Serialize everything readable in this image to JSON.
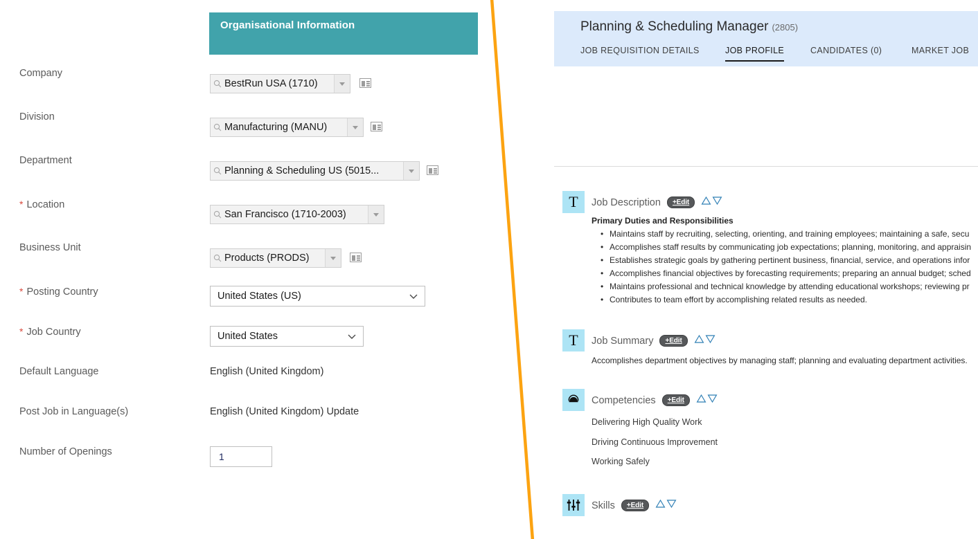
{
  "left_form": {
    "section_header": "Organisational Information",
    "fields": [
      {
        "label": "Company",
        "required": false,
        "type": "value-help",
        "value": "BestRun USA (1710)",
        "has_card_icon": true,
        "icon": "magnifier-icon"
      },
      {
        "label": "Division",
        "required": false,
        "type": "value-help",
        "value": "Manufacturing (MANU)",
        "has_card_icon": true,
        "icon": "magnifier-icon"
      },
      {
        "label": "Department",
        "required": false,
        "type": "value-help",
        "value": "Planning & Scheduling US (5015...",
        "has_card_icon": true,
        "icon": "magnifier-icon"
      },
      {
        "label": "Location",
        "required": true,
        "type": "value-help",
        "value": "San Francisco (1710-2003)",
        "has_card_icon": false,
        "icon": "magnifier-icon"
      },
      {
        "label": "Business Unit",
        "required": false,
        "type": "value-help",
        "value": "Products (PRODS)",
        "has_card_icon": true,
        "icon": "magnifier-icon"
      },
      {
        "label": "Posting Country",
        "required": true,
        "type": "select",
        "value": "United States (US)"
      },
      {
        "label": "Job Country",
        "required": true,
        "type": "select",
        "value": "United States"
      },
      {
        "label": "Default Language",
        "required": false,
        "type": "static",
        "value": "English (United Kingdom)"
      },
      {
        "label": "Post Job in Language(s)",
        "required": false,
        "type": "static",
        "value": "English (United Kingdom)  Update"
      },
      {
        "label": "Number of Openings",
        "required": false,
        "type": "number",
        "value": "1"
      }
    ]
  },
  "requisition": {
    "title": "Planning & Scheduling Manager",
    "id": "(2805)",
    "tabs": [
      {
        "label": "JOB REQUISITION DETAILS",
        "active": false
      },
      {
        "label": "JOB PROFILE",
        "active": true
      },
      {
        "label": "CANDIDATES (0)",
        "active": false
      },
      {
        "label": "MARKET JOB",
        "active": false
      }
    ]
  },
  "profile_sections": [
    {
      "title": "Job Description",
      "icon": "text-T-icon",
      "edit_label": "+Edit",
      "move_up_icon": "triangle-up-icon",
      "move_down_icon": "triangle-down-icon",
      "subheading": "Primary Duties and Responsibilities",
      "bullets": [
        "Maintains staff by recruiting, selecting, orienting, and training employees; maintaining a safe, secu",
        "Accomplishes staff results by communicating job expectations; planning, monitoring, and appraisin",
        "Establishes strategic goals by gathering pertinent business, financial, service, and operations infor",
        "Accomplishes financial objectives by forecasting requirements; preparing an annual budget; sched",
        "Maintains professional and technical knowledge by attending educational workshops; reviewing pr",
        "Contributes to team effort by accomplishing related results as needed."
      ]
    },
    {
      "title": "Job Summary",
      "icon": "text-T-icon",
      "edit_label": "+Edit",
      "move_up_icon": "triangle-up-icon",
      "move_down_icon": "triangle-down-icon",
      "paragraph": "Accomplishes department objectives by managing staff; planning and evaluating department activities."
    },
    {
      "title": "Competencies",
      "icon": "head-profile-icon",
      "edit_label": "+Edit",
      "move_up_icon": "triangle-up-icon",
      "move_down_icon": "triangle-down-icon",
      "items": [
        "Delivering High Quality Work",
        "Driving Continuous Improvement",
        "Working Safely"
      ]
    },
    {
      "title": "Skills",
      "icon": "sliders-icon",
      "edit_label": "+Edit",
      "move_up_icon": "triangle-up-icon",
      "move_down_icon": "triangle-down-icon"
    }
  ],
  "colors": {
    "section_header_teal": "#41a3ab",
    "requisition_header_blue": "#dceafb",
    "section_icon_blue": "#ade4f5",
    "annotation_orange": "#fca311",
    "required_star_red": "#d9483b",
    "triangle_outline_blue": "#2f7fb5"
  }
}
